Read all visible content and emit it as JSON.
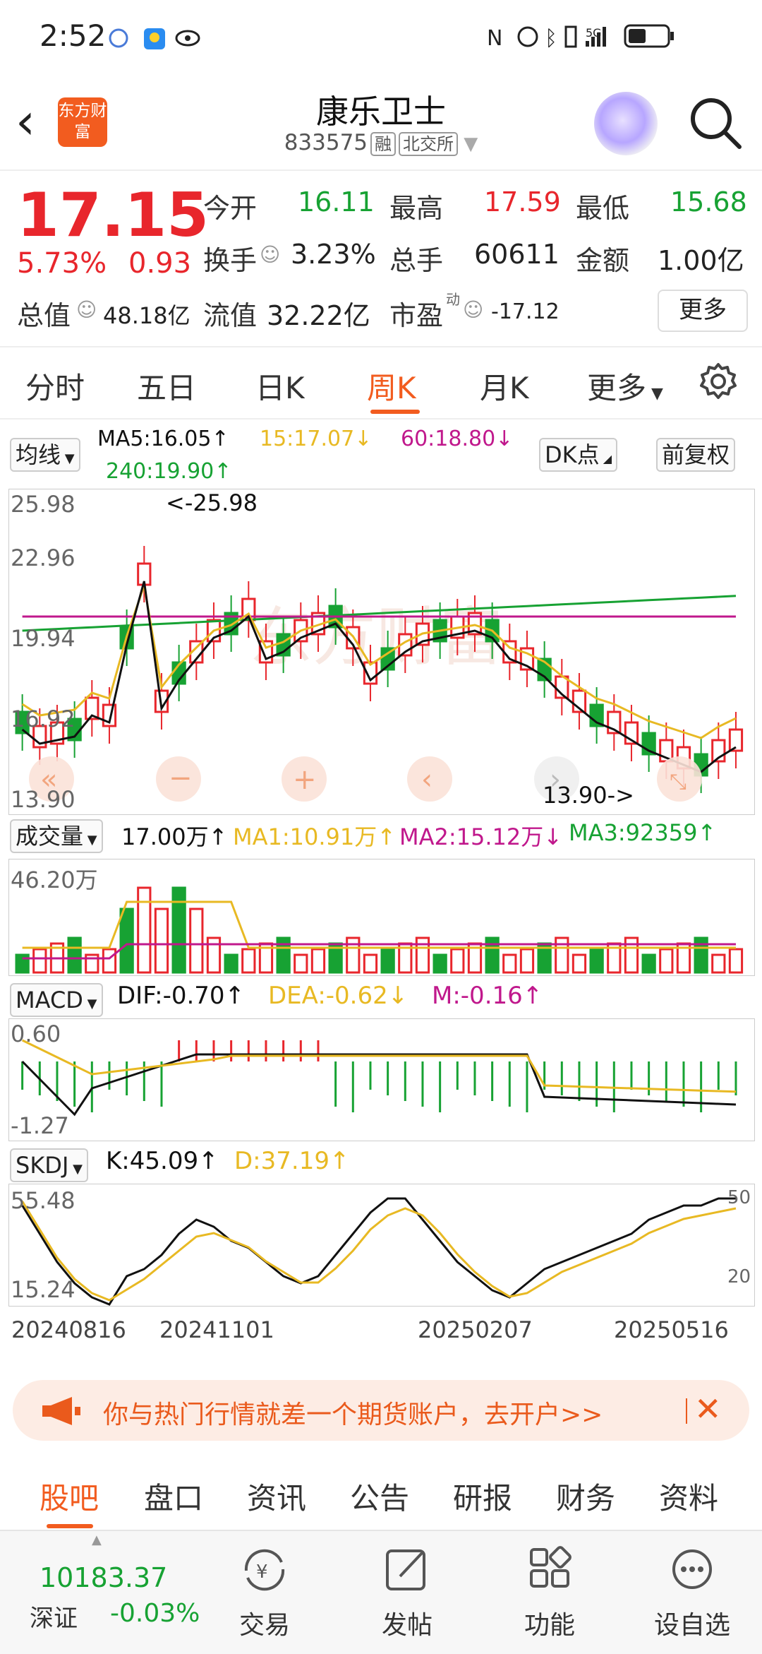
{
  "status_bar": {
    "time": "2:52",
    "icons": [
      "qq-icon",
      "weather-icon",
      "eye-icon",
      "nfc-icon",
      "alarm-icon",
      "bluetooth-icon",
      "vibrate-icon",
      "signal-icon",
      "battery-icon"
    ],
    "network": "5G"
  },
  "header": {
    "logo_text": "东方财富",
    "title": "康乐卫士",
    "code": "833575",
    "tag_margin": "融",
    "tag_exchange": "北交所"
  },
  "quote": {
    "price": "17.15",
    "change_pct": "5.73%",
    "change_abs": "0.93",
    "open_label": "今开",
    "open": "16.11",
    "high_label": "最高",
    "high": "17.59",
    "low_label": "最低",
    "low": "15.68",
    "turnover_label": "换手",
    "turnover": "3.23%",
    "volume_label": "总手",
    "volume": "60611",
    "amount_label": "金额",
    "amount": "1.00亿",
    "total_cap_label": "总值",
    "total_cap": "48.18亿",
    "float_cap_label": "流值",
    "float_cap": "32.22亿",
    "pe_label": "市盈",
    "pe_sup": "动",
    "pe": "-17.12",
    "more_label": "更多"
  },
  "tabs": {
    "items": [
      "分时",
      "五日",
      "日K",
      "周K",
      "月K",
      "更多"
    ],
    "active": "周K"
  },
  "ma_legend": {
    "selector": "均线",
    "ma5": "MA5:16.05↑",
    "ma15": "15:17.07↓",
    "ma60": "60:18.80↓",
    "ma240": "240:19.90↑",
    "dk_button": "DK点",
    "adjust_button": "前复权"
  },
  "kline": {
    "y_labels": [
      "25.98",
      "22.96",
      "19.94",
      "16.92",
      "13.90"
    ],
    "max_marker": "<-25.98",
    "min_marker": "13.90->",
    "watermark": "东方财富",
    "colors": {
      "up": "#e8262c",
      "down": "#17a233",
      "ma5": "#111111",
      "ma15": "#e8b923",
      "ma60": "#c0188c",
      "ma240": "#17a233"
    }
  },
  "volume": {
    "selector": "成交量",
    "value": "17.00万↑",
    "ma1": "MA1:10.91万↑",
    "ma2": "MA2:15.12万↓",
    "ma3": "MA3:92359↑",
    "y_label": "46.20万"
  },
  "macd": {
    "selector": "MACD",
    "dif": "DIF:-0.70↑",
    "dea": "DEA:-0.62↓",
    "m": "M:-0.16↑",
    "y_top": "0.60",
    "y_bottom": "-1.27"
  },
  "skdj": {
    "selector": "SKDJ",
    "k": "K:45.09↑",
    "d": "D:37.19↑",
    "y_top": "55.48",
    "y_bottom": "15.24",
    "right_top": "50",
    "right_bottom": "20"
  },
  "dates": [
    "20240816",
    "20241101",
    "20250207",
    "20250516"
  ],
  "promo": {
    "text": "你与热门行情就差一个期货账户，去开户>>"
  },
  "section_tabs": {
    "items": [
      "股吧",
      "盘口",
      "资讯",
      "公告",
      "研报",
      "财务",
      "资料"
    ],
    "active": "股吧"
  },
  "bottom_bar": {
    "index_value": "10183.37",
    "index_name": "深证",
    "index_change": "-0.03%",
    "buttons": [
      {
        "icon": "yen-cycle-icon",
        "label": "交易"
      },
      {
        "icon": "edit-icon",
        "label": "发帖"
      },
      {
        "icon": "grid-icon",
        "label": "功能"
      },
      {
        "icon": "more-dots-icon",
        "label": "设自选"
      }
    ]
  }
}
